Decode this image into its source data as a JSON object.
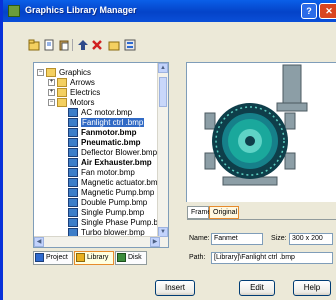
{
  "window": {
    "title": "Graphics Library Manager",
    "help_glyph": "?",
    "close_glyph": "✕"
  },
  "toolbar": {
    "icons": [
      "new-folder-icon",
      "open-icon",
      "paste-icon",
      "import-icon",
      "delete-icon",
      "folder-icon",
      "properties-icon"
    ]
  },
  "tree": {
    "items": [
      {
        "label": "Graphics",
        "level": 0,
        "kind": "folder",
        "expander": "−"
      },
      {
        "label": "Arrows",
        "level": 1,
        "kind": "folder",
        "expander": "+"
      },
      {
        "label": "Electrics",
        "level": 1,
        "kind": "folder",
        "expander": "+"
      },
      {
        "label": "Motors",
        "level": 1,
        "kind": "folder",
        "expander": "−"
      },
      {
        "label": "AC motor.bmp",
        "level": 2,
        "kind": "doc"
      },
      {
        "label": "Fanlight ctrl .bmp",
        "level": 2,
        "kind": "doc",
        "selected": true
      },
      {
        "label": "Fanmotor.bmp",
        "level": 2,
        "kind": "doc",
        "bold": true
      },
      {
        "label": "Pneumatic.bmp",
        "level": 2,
        "kind": "doc",
        "bold": true
      },
      {
        "label": "Deflector Blower.bmp",
        "level": 2,
        "kind": "doc"
      },
      {
        "label": "Air Exhauster.bmp",
        "level": 2,
        "kind": "doc",
        "bold": true
      },
      {
        "label": "Fan motor.bmp",
        "level": 2,
        "kind": "doc"
      },
      {
        "label": "Magnetic actuator.bmp",
        "level": 2,
        "kind": "doc"
      },
      {
        "label": "Magnetic Pump.bmp",
        "level": 2,
        "kind": "doc"
      },
      {
        "label": "Double Pump.bmp",
        "level": 2,
        "kind": "doc"
      },
      {
        "label": "Single Pump.bmp",
        "level": 2,
        "kind": "doc"
      },
      {
        "label": "Single Phase Pump.bmp",
        "level": 2,
        "kind": "doc"
      },
      {
        "label": "Turbo blower.bmp",
        "level": 2,
        "kind": "doc"
      }
    ]
  },
  "bottom_tabs": [
    {
      "label": "Project",
      "active": false,
      "color": "#2E6AD0"
    },
    {
      "label": "Library",
      "active": true,
      "color": "#E8B020"
    },
    {
      "label": "Disk",
      "active": false,
      "color": "#3C8C3C"
    }
  ],
  "preview_tabs": [
    {
      "label": "Frame",
      "active": false
    },
    {
      "label": "Original",
      "active": true
    }
  ],
  "details": {
    "name_label": "Name:",
    "name_value": "Fanmet",
    "size_label": "Size:",
    "size_value": "300 x 200",
    "path_label": "Path:",
    "path_value": "[Library]\\Fanlight ctrl .bmp"
  },
  "buttons": {
    "insert": "Insert",
    "edit": "Edit",
    "help": "Help"
  },
  "colors": {
    "titlebar": "#0A5FE8",
    "selection": "#316AC5",
    "motor_dark": "#0E3E4A",
    "motor_teal": "#1AA89C",
    "motor_grey": "#7A8E96"
  }
}
